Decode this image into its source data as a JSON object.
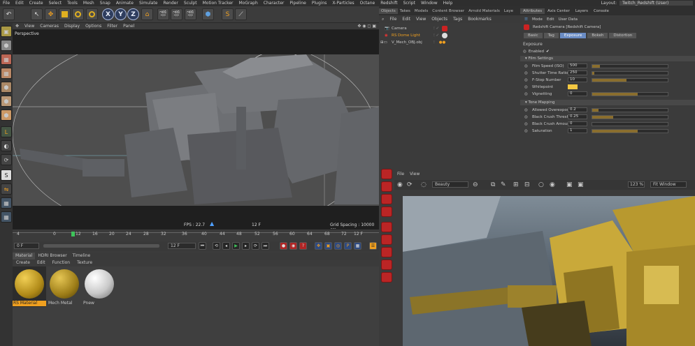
{
  "menubar": {
    "items": [
      "File",
      "Edit",
      "Create",
      "Select",
      "Tools",
      "Mesh",
      "Snap",
      "Animate",
      "Simulate",
      "Render",
      "Sculpt",
      "Motion Tracker",
      "MoGraph",
      "Character",
      "Pipeline",
      "Plugins",
      "X-Particles",
      "Octane",
      "Redshift",
      "Script",
      "Window",
      "Help"
    ],
    "layout_label": "Layout:",
    "layout_value": "Twitch_Redshift (User)"
  },
  "toolbar": {
    "axis_x": "X",
    "axis_y": "Y",
    "axis_z": "Z"
  },
  "viewport": {
    "menu": [
      "View",
      "Cameras",
      "Display",
      "Options",
      "Filter",
      "Panel"
    ],
    "label": "Perspective",
    "fps": "FPS : 22.7",
    "frame": "12 F",
    "grid_spacing": "Grid Spacing : 10000 cm"
  },
  "timeline": {
    "ticks": [
      "4",
      "0",
      "12",
      "16",
      "20",
      "24",
      "28",
      "32",
      "36",
      "40",
      "44",
      "48",
      "52",
      "56",
      "60",
      "64",
      "68",
      "72"
    ],
    "current": "12 F",
    "start_field": "0 F",
    "frame_field": "12 F",
    "end_field": "12 F"
  },
  "materials": {
    "tabs": [
      "Material",
      "HDRI Browser",
      "Timeline"
    ],
    "menu": [
      "Create",
      "Edit",
      "Function",
      "Texture"
    ],
    "items": [
      {
        "name": "RS Material",
        "selected": true
      },
      {
        "name": "Mech Metal",
        "selected": false
      },
      {
        "name": "Pnew",
        "selected": false
      }
    ]
  },
  "object_manager": {
    "tabs": [
      "Objects",
      "Takes",
      "Models",
      "Content Browser",
      "Arnold Materials",
      "Laye"
    ],
    "menu": [
      "File",
      "Edit",
      "View",
      "Objects",
      "Tags",
      "Bookmarks"
    ],
    "objects": [
      {
        "name": "Camera"
      },
      {
        "name": "RS Dome Light"
      },
      {
        "name": "V_Mech_OBJ.obj"
      }
    ]
  },
  "attributes": {
    "tabs": [
      "Attributes",
      "Axis Center",
      "Layers",
      "Console"
    ],
    "menu": [
      "Mode",
      "Edit",
      "User Data"
    ],
    "object_title": "Redshift Camera [Redshift Camera]",
    "subtabs": [
      "Basic",
      "Tag",
      "Exposure",
      "Bokeh",
      "Distortion"
    ],
    "active_subtab": "Exposure",
    "section": "Exposure",
    "enabled_label": "Enabled",
    "enabled_check": "✔",
    "film_group": "Film Settings",
    "film": [
      {
        "label": "Film Speed (ISO)",
        "value": "500",
        "fill": 0.1
      },
      {
        "label": "Shutter Time Ratio",
        "value": "250",
        "fill": 0.03
      },
      {
        "label": "F-Stop Number",
        "value": "10",
        "fill": 0.45
      },
      {
        "label": "Whitepoint",
        "value": "",
        "fill": 0
      },
      {
        "label": "Vignetting",
        "value": "0",
        "fill": 0.6
      }
    ],
    "tone_group": "Tone Mapping",
    "tone": [
      {
        "label": "Allowed Overexposure",
        "value": "0.2",
        "fill": 0.08
      },
      {
        "label": "Black Crush Threshold",
        "value": "0.25",
        "fill": 0.28
      },
      {
        "label": "Black Crush Amount",
        "value": "0",
        "fill": 0
      },
      {
        "label": "Saturation",
        "value": "1",
        "fill": 0.6
      }
    ]
  },
  "render_view": {
    "menu": [
      "File",
      "View"
    ],
    "preset": "Beauty",
    "zoom": "123 %",
    "fit": "Fit Window"
  },
  "colors": {
    "accent": "#f0a020",
    "model_grey": "#6e7074",
    "mech_yellow": "#c9a93a"
  }
}
